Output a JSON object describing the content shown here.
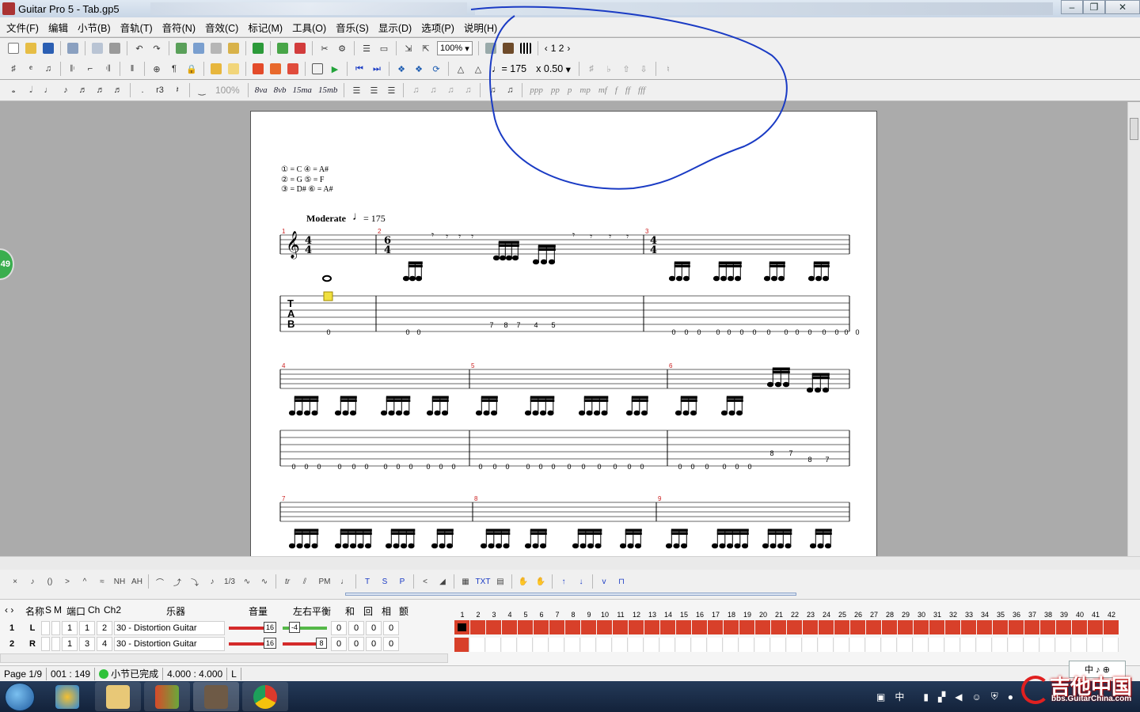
{
  "window": {
    "title": "Guitar Pro 5 - Tab.gp5"
  },
  "menu": [
    "文件(F)",
    "编辑",
    "小节(B)",
    "音轨(T)",
    "音符(N)",
    "音效(C)",
    "标记(M)",
    "工具(O)",
    "音乐(S)",
    "显示(D)",
    "选项(P)",
    "说明(H)"
  ],
  "toolbar": {
    "zoom": "100%",
    "page_prev": "‹",
    "page_nums": "1 2",
    "page_next": "›",
    "tempo": "♩= 175",
    "speed": "x 0.50",
    "velocity": "100%",
    "octave_8va": "8va",
    "octave_8vb": "8vb",
    "octave_15ma": "15ma",
    "octave_15mb": "15mb",
    "dynamics": [
      "ppp",
      "pp",
      "p",
      "mp",
      "mf",
      "f",
      "ff",
      "fff"
    ]
  },
  "score": {
    "tuning": [
      "① = C    ④ = A#",
      "② = G    ⑤ = F",
      "③ = D#   ⑥ = A#"
    ],
    "tempo_text": "Moderate",
    "tempo_value": "= 175",
    "measure_numbers": [
      "1",
      "2",
      "3",
      "4",
      "5",
      "6",
      "7",
      "8",
      "9"
    ],
    "time_sig_4": "4",
    "time_sig_6": "6",
    "tab_letters": [
      "T",
      "A",
      "B"
    ],
    "row1_frets": [
      "0",
      "0",
      "0",
      "7",
      "8",
      "7",
      "4",
      "5",
      "0",
      "0",
      "0",
      "0",
      "0",
      "0",
      "0",
      "0",
      "0",
      "0",
      "0",
      "0",
      "0",
      "0",
      "0"
    ],
    "row2_frets": [
      "0",
      "0",
      "0",
      "0",
      "0",
      "0",
      "0",
      "0",
      "0",
      "0",
      "0",
      "0",
      "0",
      "0",
      "0",
      "0",
      "0",
      "0",
      "0",
      "0",
      "0",
      "0",
      "0",
      "0",
      "0",
      "0",
      "0",
      "0",
      "0",
      "0",
      "8",
      "7",
      "8",
      "7"
    ]
  },
  "side_badge": "49",
  "effects": [
    "TXT",
    "PM",
    "T",
    "S",
    "P",
    "tr",
    "NH",
    "AH",
    "1/3"
  ],
  "tracks": {
    "headers": [
      "名称",
      "S",
      "M",
      "端口",
      "Ch",
      "Ch2",
      "乐器",
      "音量",
      "左右平衡",
      "和",
      "回",
      "相",
      "颤"
    ],
    "rows": [
      {
        "num": "1",
        "name": "L",
        "port": "1",
        "ch": "1",
        "ch2": "2",
        "instrument": "30 - Distortion Guitar",
        "vol": "16",
        "pan": "-4",
        "a": "0",
        "b": "0",
        "c": "0",
        "d": "0"
      },
      {
        "num": "2",
        "name": "R",
        "port": "1",
        "ch": "3",
        "ch2": "4",
        "instrument": "30 - Distortion Guitar",
        "vol": "16",
        "pan": "8",
        "a": "0",
        "b": "0",
        "c": "0",
        "d": "0"
      }
    ],
    "timeline_numbers": [
      "1",
      "2",
      "3",
      "4",
      "5",
      "6",
      "7",
      "8",
      "9",
      "10",
      "11",
      "12",
      "13",
      "14",
      "15",
      "16",
      "17",
      "18",
      "19",
      "20",
      "21",
      "22",
      "23",
      "24",
      "25",
      "26",
      "27",
      "28",
      "29",
      "30",
      "31",
      "32",
      "33",
      "34",
      "35",
      "36",
      "37",
      "38",
      "39",
      "40",
      "41",
      "42"
    ]
  },
  "status": {
    "page": "Page 1/9",
    "position": "001 : 149",
    "state": "小节已完成",
    "time": "4.000 : 4.000",
    "flag": "L"
  },
  "tray": {
    "ime": "中",
    "watermark": "吉他中国",
    "watermark_url": "bbs.GuitarChina.com",
    "ime_panel": "中 ♪ ⊕"
  },
  "colors": {
    "track_bar": "#d8402a",
    "volume": "#d42a2a",
    "pan": "#55b848",
    "annotation_circle": "#1a3bc4"
  }
}
